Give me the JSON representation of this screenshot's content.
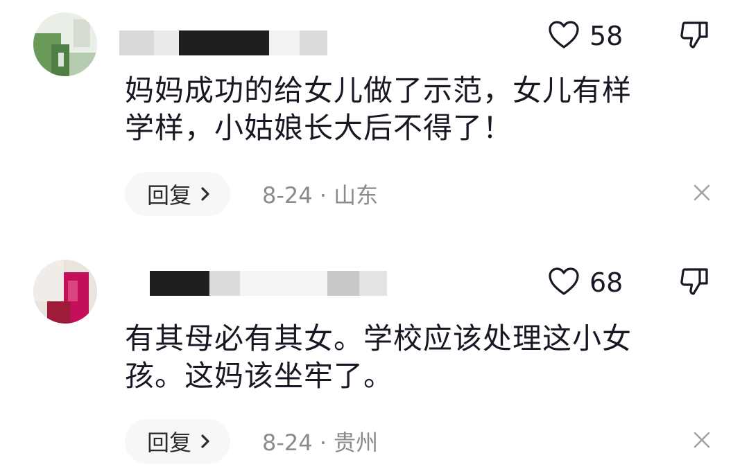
{
  "comments": [
    {
      "likes": "58",
      "text_line1": "妈妈成功的给女儿做了示范，女儿有样",
      "text_line2": "学样，小姑娘长大后不得了！",
      "reply_label": "回复",
      "date": "8-24",
      "separator": "·",
      "location": "山东"
    },
    {
      "likes": "68",
      "text_line1": "有其母必有其女。学校应该处理这小女",
      "text_line2": "孩。这妈该坐牢了。",
      "reply_label": "回复",
      "date": "8-24",
      "separator": "·",
      "location": "贵州"
    }
  ],
  "icons": {
    "like": "heart-outline-icon",
    "dislike": "thumbs-down-icon",
    "close": "close-icon",
    "reply_arrow": "chevron-right-icon"
  },
  "colors": {
    "text": "#161823",
    "meta": "#8a8a8a",
    "reply_bg": "#f7f7f7"
  }
}
